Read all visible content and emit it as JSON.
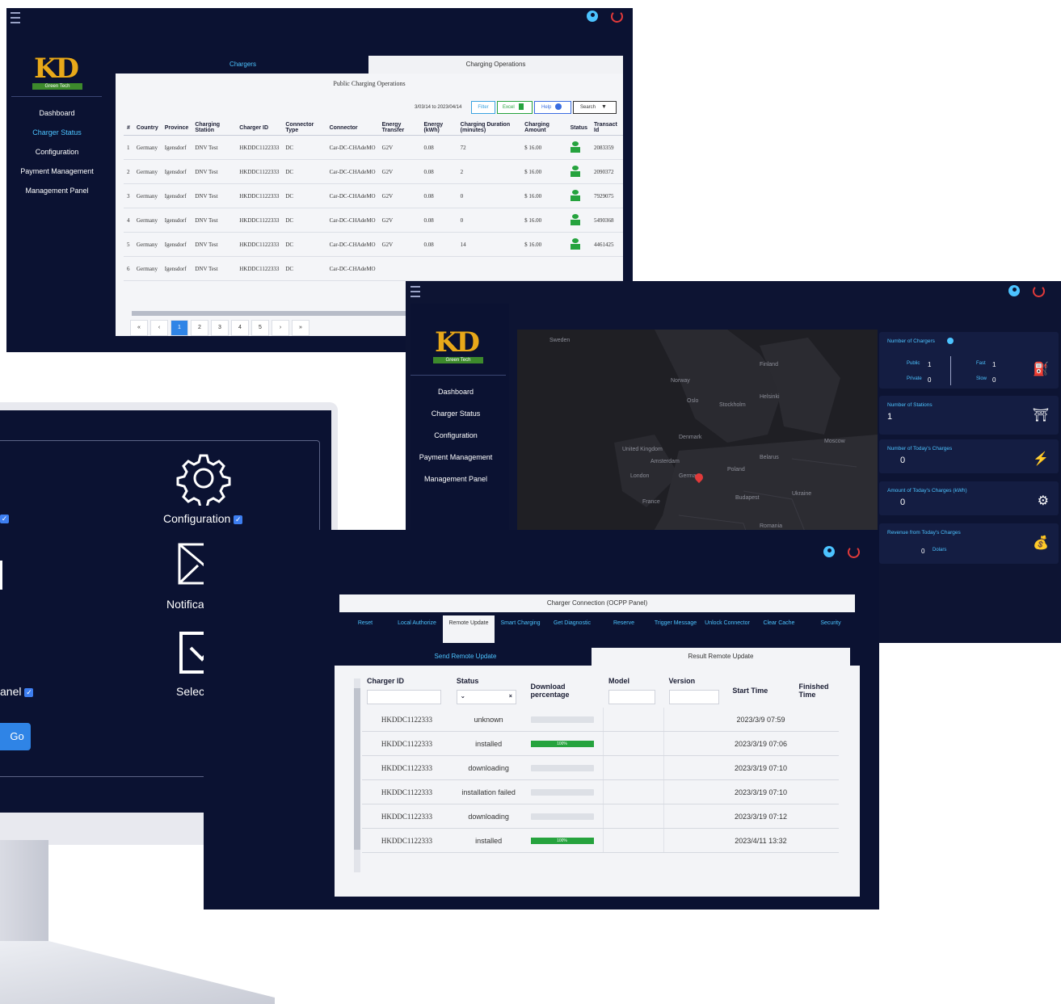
{
  "colors": {
    "navy": "#0b1232",
    "accent": "#4cc3ff",
    "power": "#e23a3a",
    "green": "#26a33e",
    "checkbox": "#3d7ef0"
  },
  "brand": {
    "logo_text": "KD",
    "logo_tagline": "Green Tech"
  },
  "nav": [
    "Dashboard",
    "Charger Status",
    "Configuration",
    "Payment Management",
    "Management Panel"
  ],
  "panel1": {
    "tabs": [
      "Chargers",
      "Charging Operations"
    ],
    "title": "Public Charging Operations",
    "date_range": "3/03/14 to 2023/04/14",
    "toolbar": {
      "filter": "Filter",
      "excel": "Excel",
      "help": "Help",
      "search": "Search"
    },
    "columns": [
      "#",
      "Country",
      "Province",
      "Charging Station",
      "Charger ID",
      "Connector Type",
      "Connector",
      "Energy Transfer",
      "Energy (kWh)",
      "Charging Duration (minutes)",
      "Charging Amount",
      "Status",
      "Transact Id"
    ],
    "rows": [
      [
        "1",
        "Germany",
        "Igensdorf",
        "DNV Test",
        "HKDDC1122333",
        "DC",
        "Car-DC-CHAdeMO",
        "G2V",
        "0.08",
        "72",
        "$ 16.00",
        "",
        "2083359"
      ],
      [
        "2",
        "Germany",
        "Igensdorf",
        "DNV Test",
        "HKDDC1122333",
        "DC",
        "Car-DC-CHAdeMO",
        "G2V",
        "0.08",
        "2",
        "$ 16.00",
        "",
        "2090372"
      ],
      [
        "3",
        "Germany",
        "Igensdorf",
        "DNV Test",
        "HKDDC1122333",
        "DC",
        "Car-DC-CHAdeMO",
        "G2V",
        "0.08",
        "0",
        "$ 16.00",
        "",
        "7929075"
      ],
      [
        "4",
        "Germany",
        "Igensdorf",
        "DNV Test",
        "HKDDC1122333",
        "DC",
        "Car-DC-CHAdeMO",
        "G2V",
        "0.08",
        "0",
        "$ 16.00",
        "",
        "5490368"
      ],
      [
        "5",
        "Germany",
        "Igensdorf",
        "DNV Test",
        "HKDDC1122333",
        "DC",
        "Car-DC-CHAdeMO",
        "G2V",
        "0.08",
        "14",
        "$ 16.00",
        "",
        "4461425"
      ],
      [
        "6",
        "Germany",
        "Igensdorf",
        "DNV Test",
        "HKDDC1122333",
        "DC",
        "Car-DC-CHAdeMO",
        "",
        "",
        "",
        "",
        "",
        ""
      ]
    ],
    "pagination": [
      "«",
      "‹",
      "1",
      "2",
      "3",
      "4",
      "5",
      "›",
      "»"
    ]
  },
  "panel2": {
    "map_labels": [
      "Sweden",
      "Finland",
      "Norway",
      "Oslo",
      "Stockholm",
      "Helsinki",
      "Denmark",
      "United Kingdom",
      "Amsterdam",
      "London",
      "Germany",
      "Poland",
      "Belarus",
      "Moscow",
      "Ukraine",
      "France",
      "Budapest",
      "Romania"
    ],
    "stats": [
      {
        "label": "Number of Chargers",
        "public_label": "Public",
        "public": "1",
        "private_label": "Private",
        "private": "0",
        "fast_label": "Fast",
        "fast": "1",
        "slow_label": "Slow",
        "slow": "0"
      },
      {
        "label": "Number of Stations",
        "value": "1"
      },
      {
        "label": "Number of Today's Charges",
        "value": "0"
      },
      {
        "label": "Amount of Today's Charges (kWh)",
        "value": "0"
      },
      {
        "label": "Revenue from Today's Charges",
        "value": "0",
        "unit": "Dolars"
      }
    ]
  },
  "panel3": {
    "items": [
      "Configuration",
      "Notifications",
      "Select All"
    ],
    "left_partial": "anel",
    "go": "Go"
  },
  "panel4": {
    "title": "Charger Connection (OCPP Panel)",
    "tabs": [
      "Reset",
      "Local Authorize",
      "Remote Update",
      "Smart Charging",
      "Get Diagnostic",
      "Reserve",
      "Trigger Message",
      "Unlock Connector",
      "Clear Cache",
      "Security"
    ],
    "subtabs": [
      "Send Remote Update",
      "Result Remote Update"
    ],
    "columns": [
      "Charger ID",
      "Status",
      "Download percentage",
      "Model",
      "Version",
      "Start Time",
      "Finished Time"
    ],
    "rows": [
      {
        "id": "HKDDC1122333",
        "status": "unknown",
        "pct": 0,
        "pct_label": "",
        "start": "2023/3/9 07:59"
      },
      {
        "id": "HKDDC1122333",
        "status": "installed",
        "pct": 1,
        "pct_label": "100%",
        "start": "2023/3/19 07:06"
      },
      {
        "id": "HKDDC1122333",
        "status": "downloading",
        "pct": 0,
        "pct_label": "",
        "start": "2023/3/19 07:10"
      },
      {
        "id": "HKDDC1122333",
        "status": "installation failed",
        "pct": 0,
        "pct_label": "",
        "start": "2023/3/19 07:10"
      },
      {
        "id": "HKDDC1122333",
        "status": "downloading",
        "pct": 0,
        "pct_label": "",
        "start": "2023/3/19 07:12"
      },
      {
        "id": "HKDDC1122333",
        "status": "installed",
        "pct": 1,
        "pct_label": "100%",
        "start": "2023/4/11 13:32"
      }
    ]
  }
}
